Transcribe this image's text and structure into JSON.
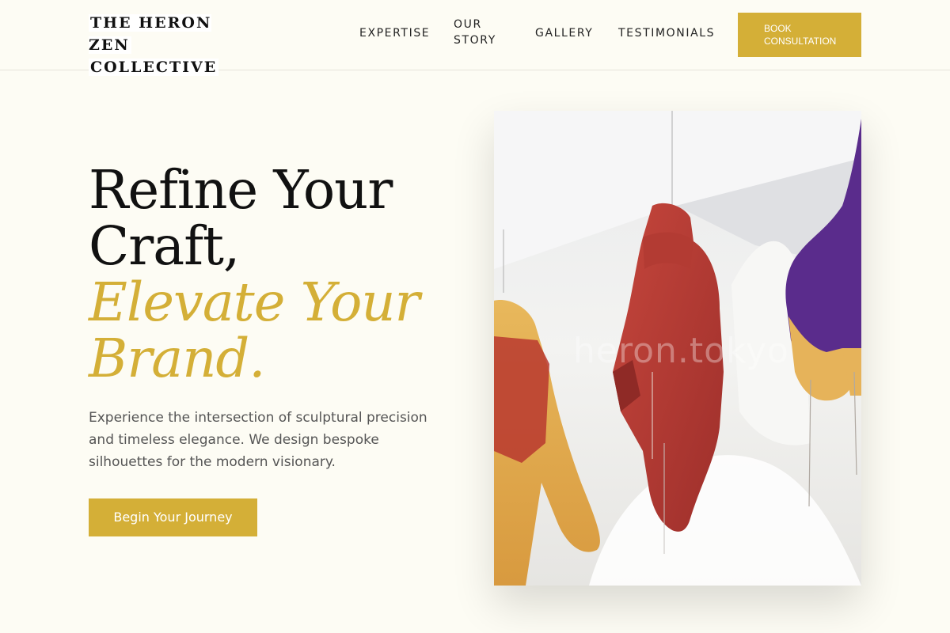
{
  "header": {
    "brand": "THE HERON ZEN COLLECTIVE",
    "brand_lines": [
      "THE HERON ZEN",
      "COLLECTIVE"
    ],
    "nav": {
      "expertise": "EXPERTISE",
      "our_story_lines": [
        "OUR",
        "STORY"
      ],
      "gallery": "GALLERY",
      "testimonials": "TESTIMONIALS"
    },
    "book_button_lines": [
      "BOOK",
      "CONSULTATION"
    ]
  },
  "hero": {
    "title_lines": [
      "Refine Your",
      "Craft,"
    ],
    "accent_lines": [
      "Elevate Your",
      "Brand."
    ],
    "description": "Experience the intersection of sculptural precision and timeless elegance. We design bespoke silhouettes for the modern visionary.",
    "cta_label": "Begin Your Journey",
    "image": {
      "watermark": "heron.tokyo",
      "icon": "hanging-garments-photo"
    }
  },
  "colors": {
    "accent": "#d4af37",
    "background": "#fdfcf4",
    "text": "#111111",
    "muted": "#555555"
  }
}
